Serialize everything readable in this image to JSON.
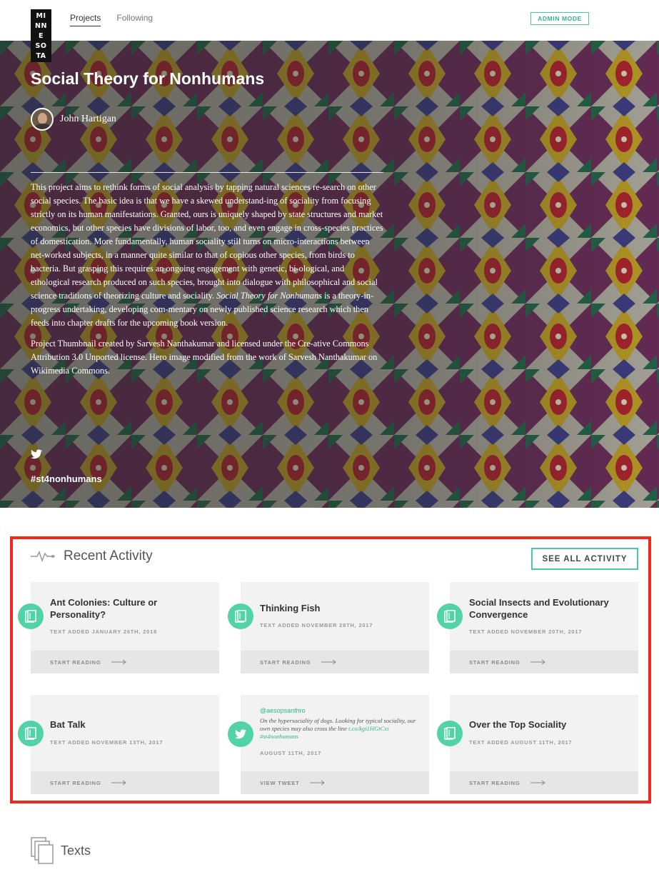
{
  "header": {
    "logo_lines": [
      "MI",
      "NN",
      "E",
      "SO",
      "TA"
    ],
    "nav": [
      {
        "label": "Projects",
        "active": true
      },
      {
        "label": "Following",
        "active": false
      }
    ],
    "admin_label": "ADMIN MODE"
  },
  "hero": {
    "title": "Social Theory for Nonhumans",
    "author": "John Hartigan",
    "description_p1_pre": "This project aims to rethink forms of social analysis by tapping natural sciences re-search on other social species. The basic idea is that we have a skewed understand-ing of sociality from focusing strictly on its human manifestations. Granted, ours is uniquely shaped by state structures and market economics, but other species have divisions of labor, too, and even engage in cross-species practices of domestication. More fundamentally, human sociality still turns on micro-interactions between net-worked subjects, in a manner quite similar to that of copious other species, from birds to bacteria. But grasping this requires an ongoing engagement with genetic, bi-ological, and ethological research produced on such species, brought into dialogue with philosophical and social science traditions of theorizing culture and sociality. ",
    "description_p1_em": "Social Theory for Nonhumans",
    "description_p1_post": " is a theory-in-progress undertaking, developing com-mentary on newly published science research which then feeds into chapter drafts for the upcoming book version.",
    "description_p2": "Project Thumbnail created by Sarvesh Nanthakumar and licensed under the Cre-ative Commons Attribution 3.0 Unported license. Hero image modified from the work of Sarvesh Nanthakumar on Wikimedia Commons.",
    "hashtag": "#st4nonhumans"
  },
  "activity": {
    "title": "Recent Activity",
    "see_all": "SEE ALL ACTIVITY",
    "cards": [
      {
        "type": "text",
        "title": "Ant Colonies: Culture or Personality?",
        "meta": "TEXT ADDED JANUARY 26TH, 2018",
        "action": "START READING"
      },
      {
        "type": "text",
        "title": "Thinking Fish",
        "meta": "TEXT ADDED NOVEMBER 28TH, 2017",
        "action": "START READING"
      },
      {
        "type": "text",
        "title": "Social Insects and Evolutionary Convergence",
        "meta": "TEXT ADDED NOVEMBER 20TH, 2017",
        "action": "START READING"
      },
      {
        "type": "text",
        "title": "Bat Talk",
        "meta": "TEXT ADDED NOVEMBER 13TH, 2017",
        "action": "START READING"
      },
      {
        "type": "tweet",
        "handle": "@aesopsanthro",
        "body": "On the hypersociality of dogs. Looking for typical sociality, our own species may also cross the line ",
        "link": "t.co/kgi1HGtCxi #st4nonhumans",
        "meta": "AUGUST 11TH, 2017",
        "action": "VIEW TWEET"
      },
      {
        "type": "text",
        "title": "Over the Top Sociality",
        "meta": "TEXT ADDED AUGUST 11TH, 2017",
        "action": "START READING"
      }
    ]
  },
  "texts": {
    "title": "Texts"
  },
  "colors": {
    "accent": "#52d2a7",
    "highlight": "#f4271c"
  }
}
